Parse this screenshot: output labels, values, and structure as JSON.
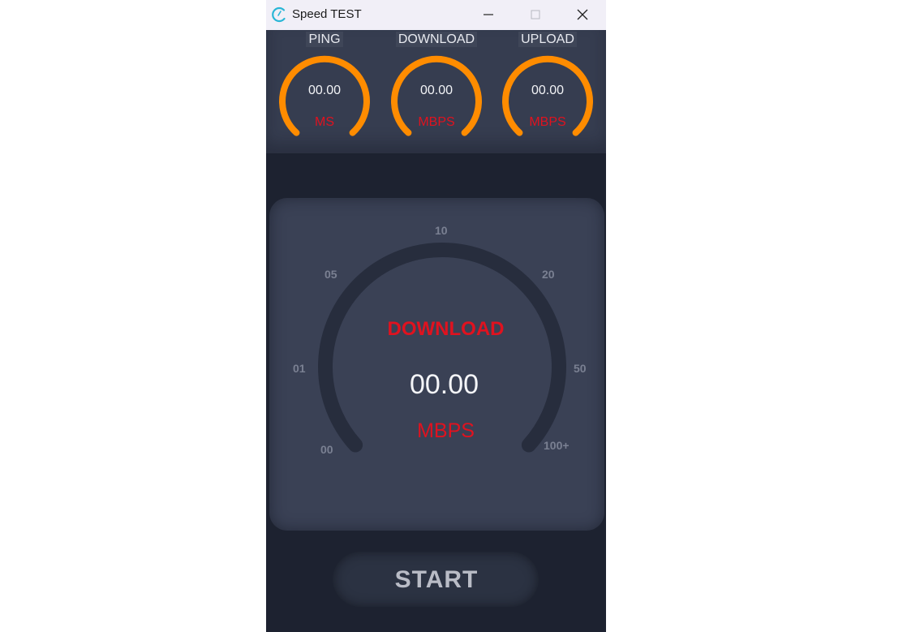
{
  "window": {
    "title": "Speed TEST",
    "icon": "speedometer-app-icon"
  },
  "mini_gauges": [
    {
      "label": "PING",
      "value": "00.00",
      "unit": "MS"
    },
    {
      "label": "DOWNLOAD",
      "value": "00.00",
      "unit": "MBPS"
    },
    {
      "label": "UPLOAD",
      "value": "00.00",
      "unit": "MBPS"
    }
  ],
  "main_gauge": {
    "label": "DOWNLOAD",
    "value": "00.00",
    "unit": "MBPS",
    "scale": [
      "00",
      "01",
      "05",
      "10",
      "20",
      "50",
      "100+"
    ]
  },
  "start_button": {
    "label": "START"
  },
  "colors": {
    "accent_orange": "#ff8c00",
    "unit_red": "#e0121f",
    "panel": "#3a4155",
    "background": "#1d2230"
  }
}
